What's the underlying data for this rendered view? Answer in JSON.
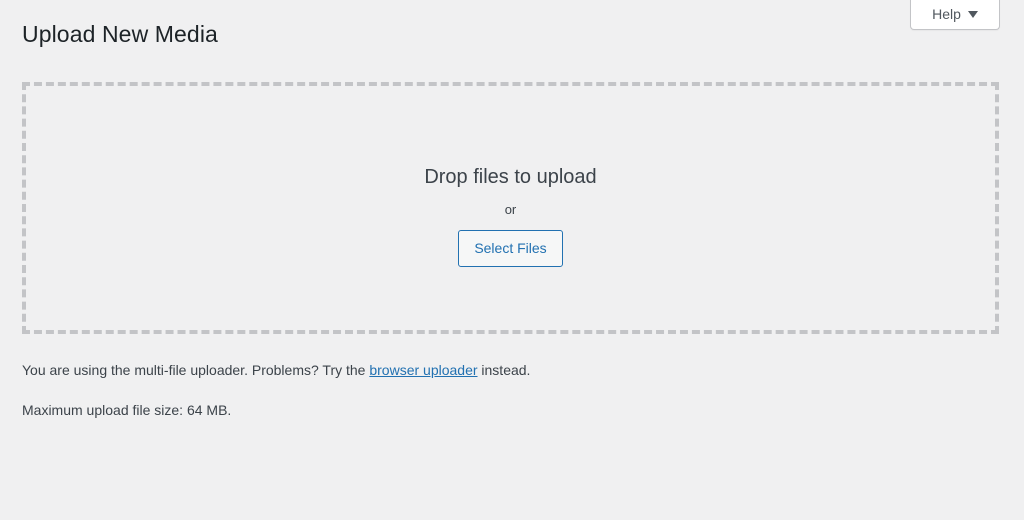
{
  "page": {
    "title": "Upload New Media",
    "background_color": "#f0f0f1"
  },
  "help_tab": {
    "label": "Help",
    "caret_icon": "chevron-down-icon"
  },
  "drop_zone": {
    "headline": "Drop files to upload",
    "separator": "or",
    "select_files_label": "Select Files",
    "border_color": "#c3c4c7"
  },
  "notes": {
    "uploader_prefix": "You are using the multi-file uploader. Problems? Try the ",
    "uploader_link": "browser uploader",
    "uploader_suffix": " instead.",
    "max_upload": "Maximum upload file size: 64 MB."
  },
  "colors": {
    "accent": "#2271b1",
    "title": "#1d2327",
    "text": "#3c434a"
  }
}
